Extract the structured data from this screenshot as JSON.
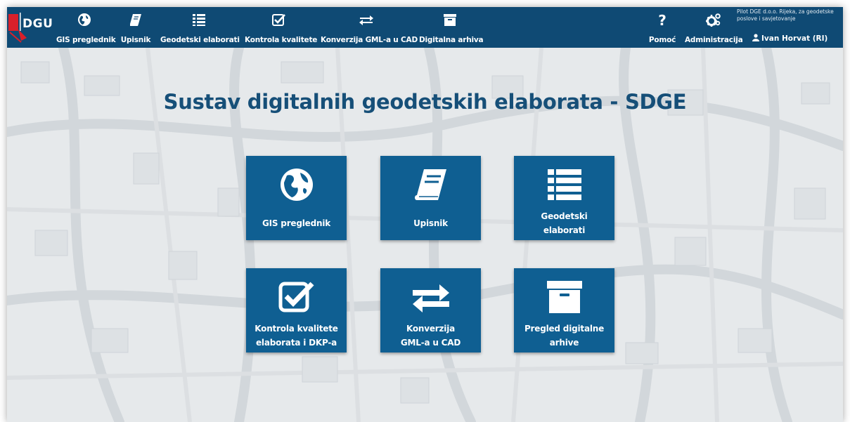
{
  "logo": {
    "text": "DGU"
  },
  "nav": {
    "items": [
      {
        "label": "GIS preglednik",
        "icon": "globe-icon"
      },
      {
        "label": "Upisnik",
        "icon": "book-icon"
      },
      {
        "label": "Geodetski elaborati",
        "icon": "list-icon"
      },
      {
        "label": "Kontrola kvalitete",
        "icon": "checkbox-icon"
      },
      {
        "label": "Konverzija GML-a u CAD",
        "icon": "exchange-icon"
      },
      {
        "label": "Digitalna arhiva",
        "icon": "archive-icon"
      }
    ],
    "right": [
      {
        "label": "Pomoć",
        "icon": "question-icon"
      },
      {
        "label": "Administracija",
        "icon": "gears-icon"
      }
    ]
  },
  "org": {
    "text": "Pilot DGE d.o.o. Rijeka, za geodetske poslove i savjetovanje"
  },
  "user": {
    "name": "Ivan Horvat (RI)"
  },
  "page": {
    "title": "Sustav digitalnih geodetskih elaborata - SDGE"
  },
  "tiles": [
    {
      "line1": "GIS preglednik",
      "line2": "",
      "icon": "globe-icon"
    },
    {
      "line1": "Upisnik",
      "line2": "",
      "icon": "book-icon"
    },
    {
      "line1": "Geodetski",
      "line2": "elaborati",
      "icon": "list-icon"
    },
    {
      "line1": "Kontrola kvalitete",
      "line2": "elaborata i DKP-a",
      "icon": "checkbox-icon"
    },
    {
      "line1": "Konverzija",
      "line2": "GML-a u CAD",
      "icon": "exchange-icon"
    },
    {
      "line1": "Pregled digitalne",
      "line2": "arhive",
      "icon": "archive-icon"
    }
  ],
  "colors": {
    "navbar": "#0f4a74",
    "tile": "#0f5f92",
    "title": "#164f78",
    "logo_red": "#d9202a"
  }
}
